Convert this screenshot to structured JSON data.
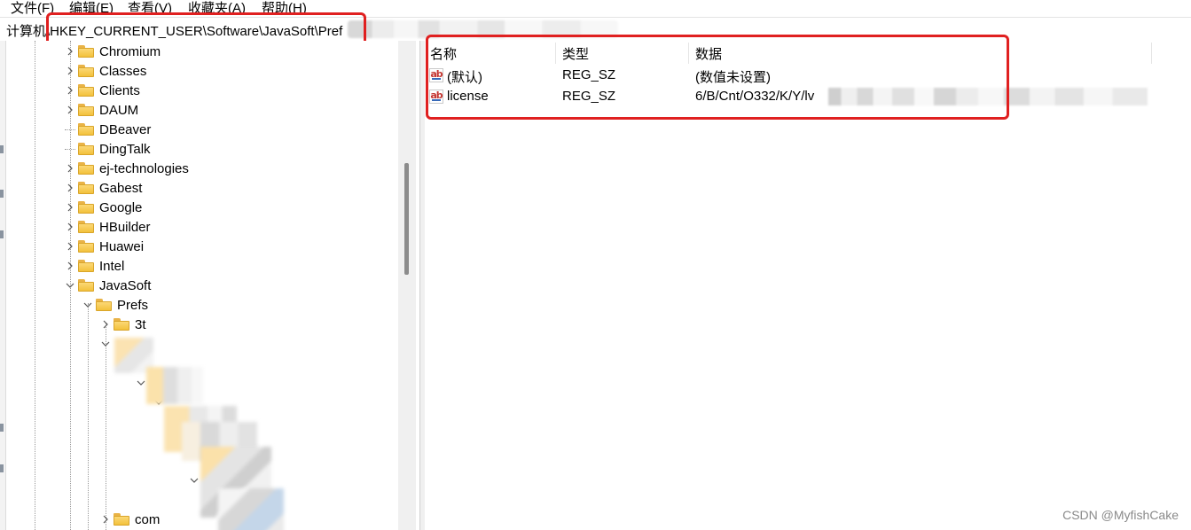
{
  "menu": {
    "file": "文件(F)",
    "edit": "编辑(E)",
    "view": "查看(V)",
    "favorites": "收藏夹(A)",
    "help": "帮助(H)"
  },
  "address": {
    "path": "计算机\\HKEY_CURRENT_USER\\Software\\JavaSoft\\Pref"
  },
  "tree": {
    "items": [
      {
        "label": "Chromium"
      },
      {
        "label": "Classes"
      },
      {
        "label": "Clients"
      },
      {
        "label": "DAUM"
      },
      {
        "label": "DBeaver"
      },
      {
        "label": "DingTalk"
      },
      {
        "label": "ej-technologies"
      },
      {
        "label": "Gabest"
      },
      {
        "label": "Google"
      },
      {
        "label": "HBuilder"
      },
      {
        "label": "Huawei"
      },
      {
        "label": "Intel"
      },
      {
        "label": "JavaSoft"
      },
      {
        "label": "Prefs"
      },
      {
        "label": "3t"
      },
      {
        "label": "com"
      }
    ]
  },
  "list": {
    "columns": [
      "名称",
      "类型",
      "数据"
    ],
    "rows": [
      {
        "name": "(默认)",
        "type": "REG_SZ",
        "data": "(数值未设置)",
        "icon": "string-value-icon"
      },
      {
        "name": "license",
        "type": "REG_SZ",
        "data": "6/B/Cnt/O332/K/Y/lv",
        "icon": "string-value-icon"
      }
    ]
  },
  "watermark": "CSDN @MyfishCake",
  "colors": {
    "highlight": "#e02020",
    "folder": "#f3c13b",
    "scrollbar_thumb": "#8c8c8c"
  }
}
